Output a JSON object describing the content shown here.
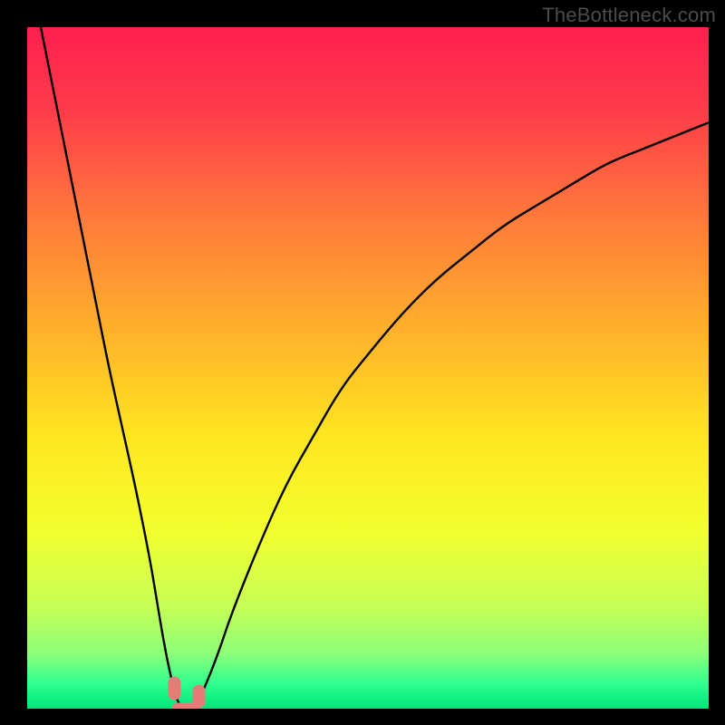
{
  "watermark": {
    "text": "TheBottleneck.com"
  },
  "chart_data": {
    "type": "line",
    "title": "",
    "xlabel": "",
    "ylabel": "",
    "xlim": [
      0,
      100
    ],
    "ylim": [
      0,
      100
    ],
    "grid": false,
    "legend": false,
    "series": [
      {
        "name": "bottleneck-curve",
        "x": [
          2,
          4,
          6,
          8,
          10,
          12,
          14,
          16,
          18,
          19,
          20,
          21,
          22,
          23,
          24,
          25,
          26,
          28,
          30,
          34,
          38,
          42,
          46,
          50,
          55,
          60,
          65,
          70,
          75,
          80,
          85,
          90,
          95,
          100
        ],
        "y": [
          100,
          90,
          80,
          70,
          60,
          50,
          41,
          32,
          22,
          16,
          10,
          5,
          1,
          0,
          0,
          1,
          3,
          8,
          14,
          24,
          33,
          40,
          47,
          52,
          58,
          63,
          67,
          71,
          74,
          77,
          80,
          82,
          84,
          86
        ]
      }
    ],
    "markers": [
      {
        "name": "left-marker",
        "x": 21.6,
        "y": 3.0
      },
      {
        "name": "right-marker",
        "x": 25.2,
        "y": 1.8
      },
      {
        "name": "bottom-marker",
        "x": 23.2,
        "y": 0.0
      }
    ],
    "gradient_stops": [
      {
        "offset": 0.0,
        "color": "#ff1f4f"
      },
      {
        "offset": 0.12,
        "color": "#ff3b4a"
      },
      {
        "offset": 0.28,
        "color": "#ff7a3a"
      },
      {
        "offset": 0.45,
        "color": "#ffb22b"
      },
      {
        "offset": 0.6,
        "color": "#ffe61f"
      },
      {
        "offset": 0.74,
        "color": "#f2ff2e"
      },
      {
        "offset": 0.85,
        "color": "#c6ff55"
      },
      {
        "offset": 0.92,
        "color": "#8bff7a"
      },
      {
        "offset": 0.965,
        "color": "#2bff8e"
      },
      {
        "offset": 1.0,
        "color": "#00e47a"
      }
    ],
    "marker_style": {
      "fill": "#e77b77",
      "rx": 7
    }
  }
}
